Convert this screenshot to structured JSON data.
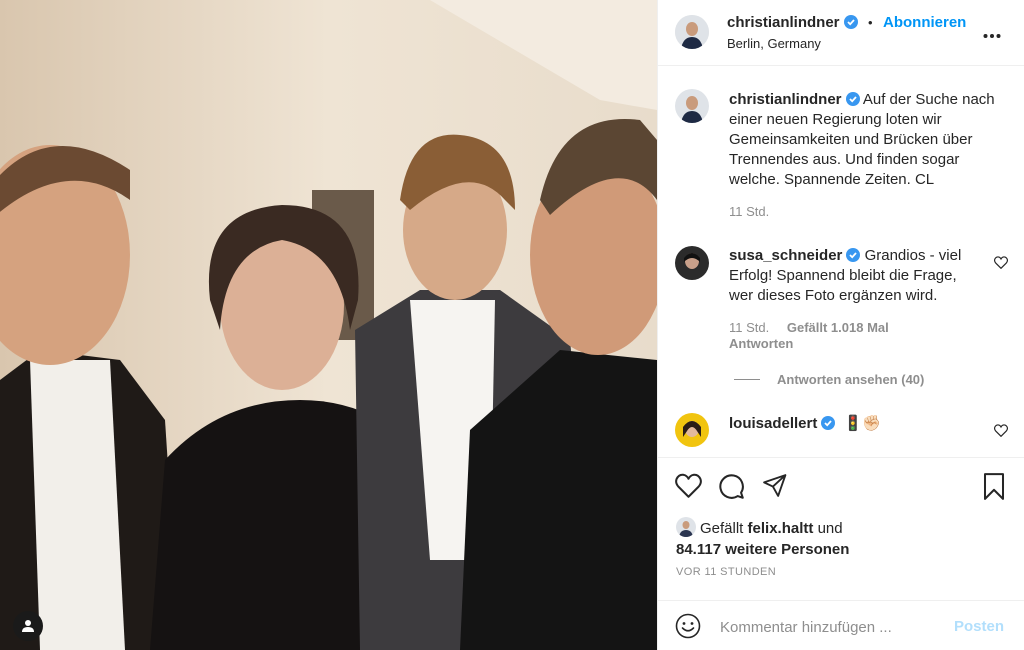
{
  "photo": {
    "alt_icon": "user-icon"
  },
  "header": {
    "username": "christianlindner",
    "separator": "•",
    "follow_label": "Abonnieren",
    "location": "Berlin, Germany",
    "more_icon": "more-dots-icon"
  },
  "caption": {
    "username": "christianlindner",
    "text": "Auf der Suche nach einer neuen Regierung loten wir Gemeinsamkeiten und Brücken über Trennendes aus. Und finden sogar welche. Spannende Zeiten. CL",
    "time": "11 Std."
  },
  "comments": [
    {
      "username": "susa_schneider",
      "text": "Grandios - viel Erfolg! Spannend bleibt die Frage, wer dieses Foto ergänzen wird.",
      "time": "11 Std.",
      "likes": "Gefällt 1.018 Mal",
      "reply": "Antworten",
      "view_replies": "Antworten ansehen (40)"
    },
    {
      "username": "louisadellert",
      "text": "🚦✊🏻"
    }
  ],
  "actions": {
    "like_icon": "heart-icon",
    "comment_icon": "comment-icon",
    "share_icon": "share-icon",
    "save_icon": "bookmark-icon"
  },
  "likes": {
    "prefix": "Gefällt",
    "user": "felix.haltt",
    "middle": "und",
    "count": "84.117 weitere Personen"
  },
  "timestamp": "VOR 11 STUNDEN",
  "add_comment": {
    "placeholder": "Kommentar hinzufügen ...",
    "post_label": "Posten"
  },
  "colors": {
    "accent": "#0095f6",
    "verified": "#3897f0",
    "post_disabled": "#b2dffc",
    "muted": "#8e8e8e"
  }
}
